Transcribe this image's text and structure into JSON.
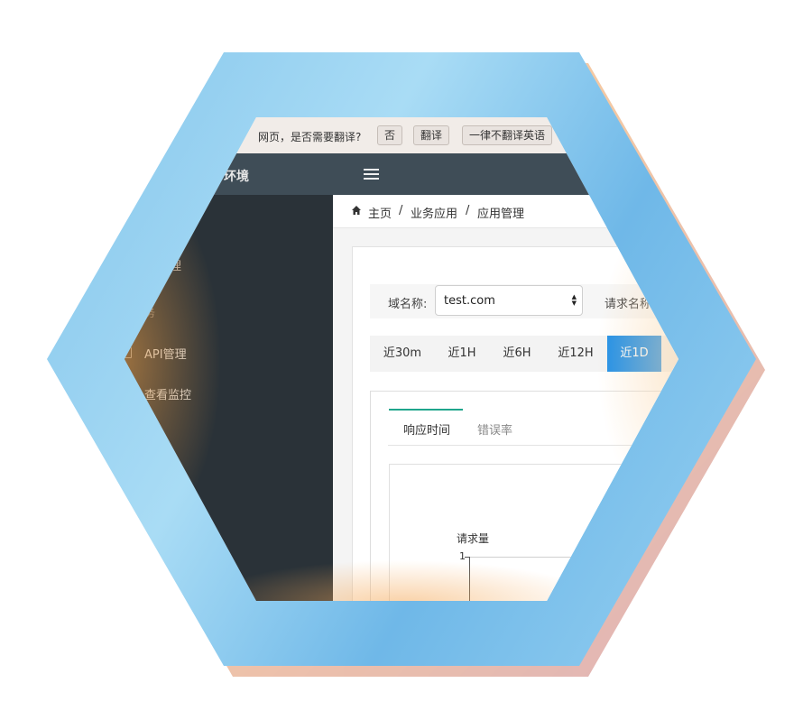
{
  "translate_bar": {
    "prompt": "网页，是否需要翻译?",
    "no_label": "否",
    "translate_label": "翻译",
    "never_label": "一律不翻译英语"
  },
  "topnav": {
    "brand": "环境",
    "menu_icon": "hamburger-icon"
  },
  "sidebar": {
    "items": [
      {
        "label": "理"
      },
      {
        "label": "务"
      },
      {
        "label": "API管理",
        "icon": "doc-icon"
      },
      {
        "label": "查看监控"
      }
    ]
  },
  "breadcrumb": {
    "home_icon": "home-icon",
    "items": [
      "主页",
      "业务应用",
      "应用管理"
    ],
    "separator": "/"
  },
  "filters": {
    "domain_label": "域名称:",
    "domain_value": "test.com",
    "request_label": "请求名称"
  },
  "time_ranges": {
    "options": [
      "近30m",
      "近1H",
      "近6H",
      "近12H",
      "近1D"
    ],
    "active": "近1D"
  },
  "tabs": {
    "items": [
      "响应时间",
      "错误率"
    ],
    "active": "响应时间"
  },
  "chart_data": {
    "type": "line",
    "ylabel": "请求量",
    "y_ticks": [
      "1"
    ],
    "series": []
  },
  "colors": {
    "accent": "#1e8fe8",
    "tab_accent": "#1fa58c",
    "sidebar_bg": "#2a3238",
    "topnav_bg": "#3f4d57",
    "frame_blue": "#7cc0ea"
  }
}
